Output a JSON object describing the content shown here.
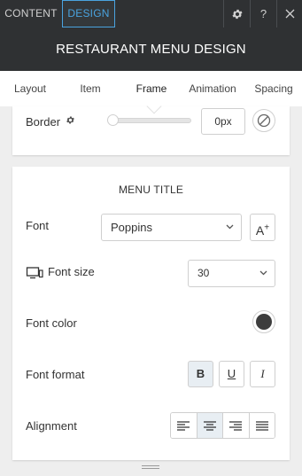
{
  "topbar": {
    "tabs": [
      {
        "label": "CONTENT",
        "active": false
      },
      {
        "label": "DESIGN",
        "active": true
      }
    ],
    "icons": [
      "gear-icon",
      "help-icon",
      "close-icon"
    ],
    "help_label": "?",
    "accent_color": "#4aa3df"
  },
  "title": "RESTAURANT MENU DESIGN",
  "subnav": {
    "items": [
      "Layout",
      "Item",
      "Frame",
      "Animation",
      "Spacing"
    ],
    "active": "Frame"
  },
  "border_section": {
    "label": "Border",
    "value": "0px",
    "slider_fraction": 0
  },
  "menu_title_section": {
    "heading": "MENU TITLE",
    "font": {
      "label": "Font",
      "value": "Poppins",
      "add_font_label": "A+"
    },
    "font_size": {
      "label": "Font size",
      "value": "30"
    },
    "font_color": {
      "label": "Font color",
      "value": "#3d3d3d"
    },
    "font_format": {
      "label": "Font format",
      "bold": "B",
      "underline": "U",
      "italic": "I",
      "active": "bold"
    },
    "alignment": {
      "label": "Alignment",
      "options": [
        "left",
        "center",
        "right",
        "justify"
      ],
      "active": "center"
    }
  }
}
